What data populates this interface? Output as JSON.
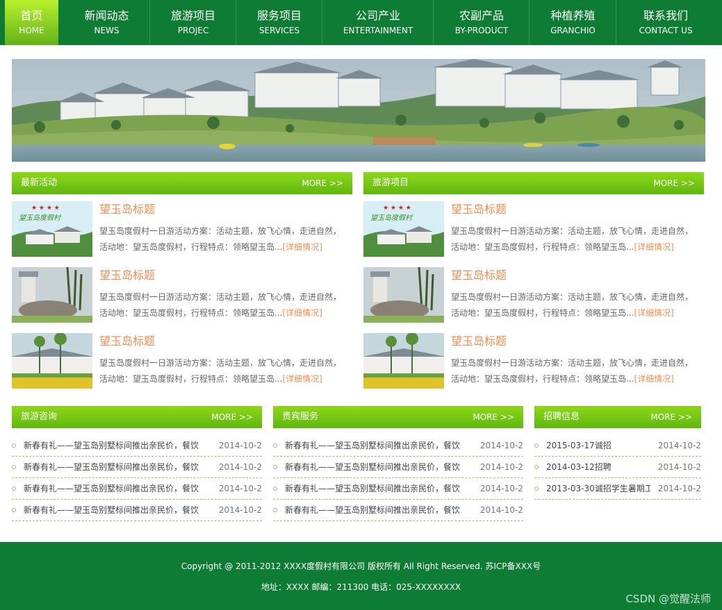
{
  "nav": {
    "items": [
      {
        "cn": "首页",
        "en": "HOME"
      },
      {
        "cn": "新闻动态",
        "en": "NEWS"
      },
      {
        "cn": "旅游项目",
        "en": "PROJEC"
      },
      {
        "cn": "服务项目",
        "en": "SERVICES"
      },
      {
        "cn": "公司产业",
        "en": "ENTERTAINMENT"
      },
      {
        "cn": "农副产品",
        "en": "BY-PRODUCT"
      },
      {
        "cn": "种植养殖",
        "en": "GRANCHIO"
      },
      {
        "cn": "联系我们",
        "en": "CONTACT US"
      }
    ]
  },
  "sections": {
    "latest": {
      "title": "最新活动",
      "more": "MORE >>"
    },
    "tours": {
      "title": "旅游项目",
      "more": "MORE >>"
    },
    "consult": {
      "title": "旅游咨询",
      "more": "MORE >>"
    },
    "vip": {
      "title": "贵宾服务",
      "more": "MORE >>"
    },
    "jobs": {
      "title": "招聘信息",
      "more": "MORE >>"
    }
  },
  "articles": {
    "title": "望玉岛标题",
    "text": "望玉岛度假村一日游活动方案：活动主题，放飞心情，走进自然，活动地：望玉岛度假村，行程特点：领略望玉岛...",
    "detail": "[详细情况]",
    "logo_text": "望玉岛度假村"
  },
  "news": {
    "text": "新春有礼——望玉岛别墅标间推出亲民价，餐饮",
    "date": "2014-10-2"
  },
  "jobs_list": [
    {
      "text": "2015-03-17诚招",
      "date": "2014-10-2"
    },
    {
      "text": "2014-03-12招聘",
      "date": "2014-10-2"
    },
    {
      "text": "2013-03-30诚招学生暑期工",
      "date": "2014-10-2"
    }
  ],
  "footer": {
    "copyright": "Copyright @ 2011-2012 XXXX度假村有限公司 版权所有 All Right Reserved. 苏ICP备XXX号",
    "address": "地址：XXXX 邮编：211300 电话：025-XXXXXXXX",
    "watermark": "CSDN @觉醒法师"
  },
  "colors": {
    "nav": "#0e7c34",
    "accent": "#7cc81a",
    "title": "#ef8d52"
  }
}
